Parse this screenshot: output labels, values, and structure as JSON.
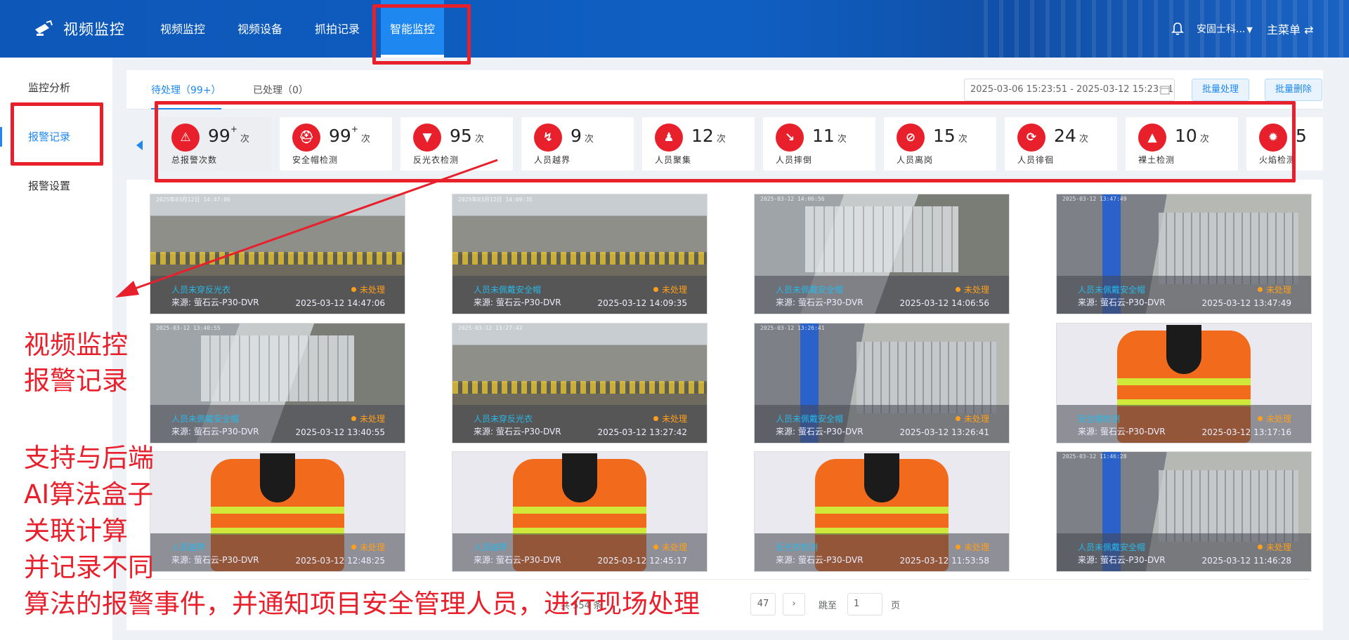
{
  "header": {
    "app_title": "视频监控",
    "nav": [
      {
        "label": "视频监控"
      },
      {
        "label": "视频设备"
      },
      {
        "label": "抓拍记录"
      },
      {
        "label": "智能监控"
      }
    ],
    "active_nav": "智能监控",
    "company": "安固士科...",
    "main_menu": "主菜单 ⇄"
  },
  "sidebar": {
    "items": [
      {
        "label": "监控分析"
      },
      {
        "label": "报警记录"
      },
      {
        "label": "报警设置"
      }
    ],
    "active_item": "报警记录"
  },
  "toolbar": {
    "tabs": [
      {
        "label": "待处理（99+）"
      },
      {
        "label": "已处理（0）"
      }
    ],
    "active_tab": "待处理（99+）",
    "date_range": "2025-03-06 15:23:51 - 2025-03-12 15:23:51",
    "batch_process": "批量处理",
    "batch_delete": "批量删除"
  },
  "stats": [
    {
      "count": "99",
      "plus": "+",
      "unit": "次",
      "label": "总报警次数",
      "icon": "alarm-icon"
    },
    {
      "count": "99",
      "plus": "+",
      "unit": "次",
      "label": "安全帽检测",
      "icon": "helmet-icon"
    },
    {
      "count": "95",
      "plus": "",
      "unit": "次",
      "label": "反光衣检测",
      "icon": "vest-icon"
    },
    {
      "count": "9",
      "plus": "",
      "unit": "次",
      "label": "人员越界",
      "icon": "boundary-icon"
    },
    {
      "count": "12",
      "plus": "",
      "unit": "次",
      "label": "人员聚集",
      "icon": "crowd-icon"
    },
    {
      "count": "11",
      "plus": "",
      "unit": "次",
      "label": "人员摔倒",
      "icon": "fall-icon"
    },
    {
      "count": "15",
      "plus": "",
      "unit": "次",
      "label": "人员离岗",
      "icon": "off-post-icon"
    },
    {
      "count": "24",
      "plus": "",
      "unit": "次",
      "label": "人员徘徊",
      "icon": "loiter-icon"
    },
    {
      "count": "10",
      "plus": "",
      "unit": "次",
      "label": "裸土检测",
      "icon": "soil-icon"
    },
    {
      "count": "5",
      "plus": "",
      "unit": "",
      "label": "火焰检测",
      "icon": "flame-icon"
    }
  ],
  "records": [
    {
      "type": "人员未穿反光衣",
      "status": "未处理",
      "source": "来源: 萤石云-P30-DVR",
      "time": "2025-03-12 14:47:06",
      "scene": "site",
      "stamp": "2025年03月12日 14:47:06"
    },
    {
      "type": "人员未佩戴安全帽",
      "status": "未处理",
      "source": "来源: 萤石云-P30-DVR",
      "time": "2025-03-12 14:09:35",
      "scene": "site",
      "stamp": "2025年03月12日 14:09:35"
    },
    {
      "type": "人员未佩戴安全帽",
      "status": "未处理",
      "source": "来源: 萤石云-P30-DVR",
      "time": "2025-03-12 14:06:56",
      "scene": "fence",
      "stamp": "2025-03-12 14:06:56"
    },
    {
      "type": "人员未佩戴安全帽",
      "status": "未处理",
      "source": "来源: 萤石云-P30-DVR",
      "time": "2025-03-12 13:47:49",
      "scene": "banner",
      "stamp": "2025-03-12 13:47:49"
    },
    {
      "type": "人员未佩戴安全帽",
      "status": "未处理",
      "source": "来源: 萤石云-P30-DVR",
      "time": "2025-03-12 13:40:55",
      "scene": "fence",
      "stamp": "2025-03-12 13:40:55"
    },
    {
      "type": "人员未穿反光衣",
      "status": "未处理",
      "source": "来源: 萤石云-P30-DVR",
      "time": "2025-03-12 13:27:42",
      "scene": "site",
      "stamp": "2025-03-12 13:27:42"
    },
    {
      "type": "人员未佩戴安全帽",
      "status": "未处理",
      "source": "来源: 萤石云-P30-DVR",
      "time": "2025-03-12 13:26:41",
      "scene": "banner",
      "stamp": "2025-03-12 13:26:41"
    },
    {
      "type": "安全帽检测",
      "status": "未处理",
      "source": "来源: 萤石云-P30-DVR",
      "time": "2025-03-12 13:17:16",
      "scene": "vest",
      "stamp": ""
    },
    {
      "type": "人员越界",
      "status": "未处理",
      "source": "来源: 萤石云-P30-DVR",
      "time": "2025-03-12 12:48:25",
      "scene": "vest",
      "stamp": ""
    },
    {
      "type": "人员越界",
      "status": "未处理",
      "source": "来源: 萤石云-P30-DVR",
      "time": "2025-03-12 12:45:17",
      "scene": "vest",
      "stamp": ""
    },
    {
      "type": "反光衣检测",
      "status": "未处理",
      "source": "来源: 萤石云-P30-DVR",
      "time": "2025-03-12 11:53:58",
      "scene": "vest",
      "stamp": ""
    },
    {
      "type": "人员未佩戴安全帽",
      "status": "未处理",
      "source": "来源: 萤石云-P30-DVR",
      "time": "2025-03-12 11:46:28",
      "scene": "banner",
      "stamp": "2025-03-12 11:46:28"
    }
  ],
  "pagination": {
    "total": "共 554 条",
    "last_page": "47",
    "next": "›",
    "jump_label": "跳至",
    "page_input": "1",
    "page_suffix": "页"
  },
  "annotations": {
    "title_lines": [
      "视频监控",
      "报警记录"
    ],
    "desc_lines": [
      "支持与后端",
      "AI算法盒子",
      "关联计算",
      "并记录不同",
      "算法的报警事件，并通知项目安全管理人员，进行现场处理"
    ],
    "color": "#e8202c"
  }
}
